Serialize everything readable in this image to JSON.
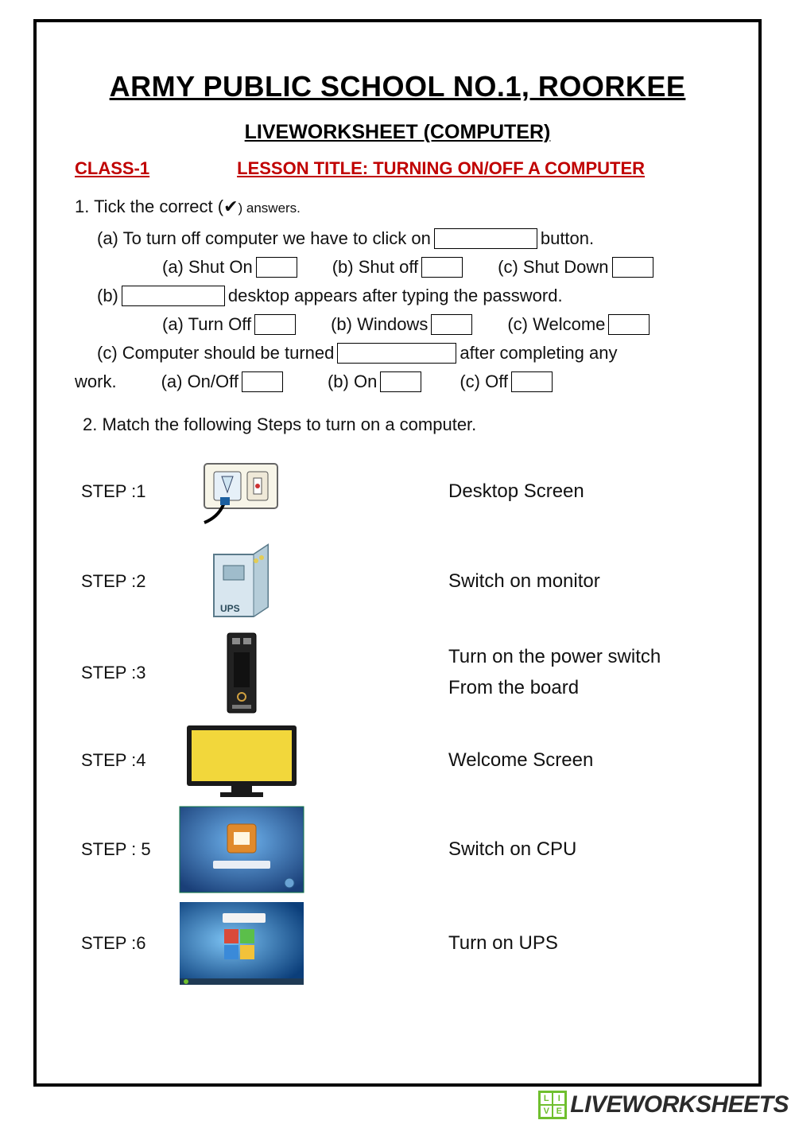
{
  "header": {
    "title": "ARMY PUBLIC SCHOOL NO.1, ROORKEE",
    "subtitle": "LIVEWORKSHEET (COMPUTER)",
    "class": "CLASS-1",
    "lesson": "LESSON TITLE: TURNING ON/OFF A COMPUTER"
  },
  "q1": {
    "prompt_pre": "1. Tick the correct (",
    "check": "✔",
    "prompt_post": ") answers.",
    "a": {
      "text_pre": "(a) To turn off computer we have to click on",
      "text_post": "button.",
      "opt_a": "(a)  Shut On",
      "opt_b": "(b) Shut off",
      "opt_c": "(c) Shut Down"
    },
    "b": {
      "text_pre": "(b)",
      "text_post": "desktop appears after typing the password.",
      "opt_a": "(a)  Turn Off",
      "opt_b": "(b) Windows",
      "opt_c": "(c) Welcome"
    },
    "c": {
      "text_pre": "(c) Computer should be turned",
      "text_post": "after completing any",
      "line2_pre": "work.",
      "opt_a": "(a) On/Off",
      "opt_b": "(b) On",
      "opt_c": "(c) Off"
    }
  },
  "q2": {
    "prompt": "2. Match the following Steps to turn on a computer.",
    "left": [
      "STEP :1",
      "STEP :2",
      "STEP :3",
      "STEP :4",
      "STEP : 5",
      "STEP :6"
    ],
    "right": [
      "Desktop Screen",
      "Switch on monitor",
      "Turn on the power switch",
      "From the board",
      "Welcome Screen",
      "Switch on CPU",
      "Turn on UPS"
    ]
  },
  "watermark": "LIVEWORKSHEETS"
}
